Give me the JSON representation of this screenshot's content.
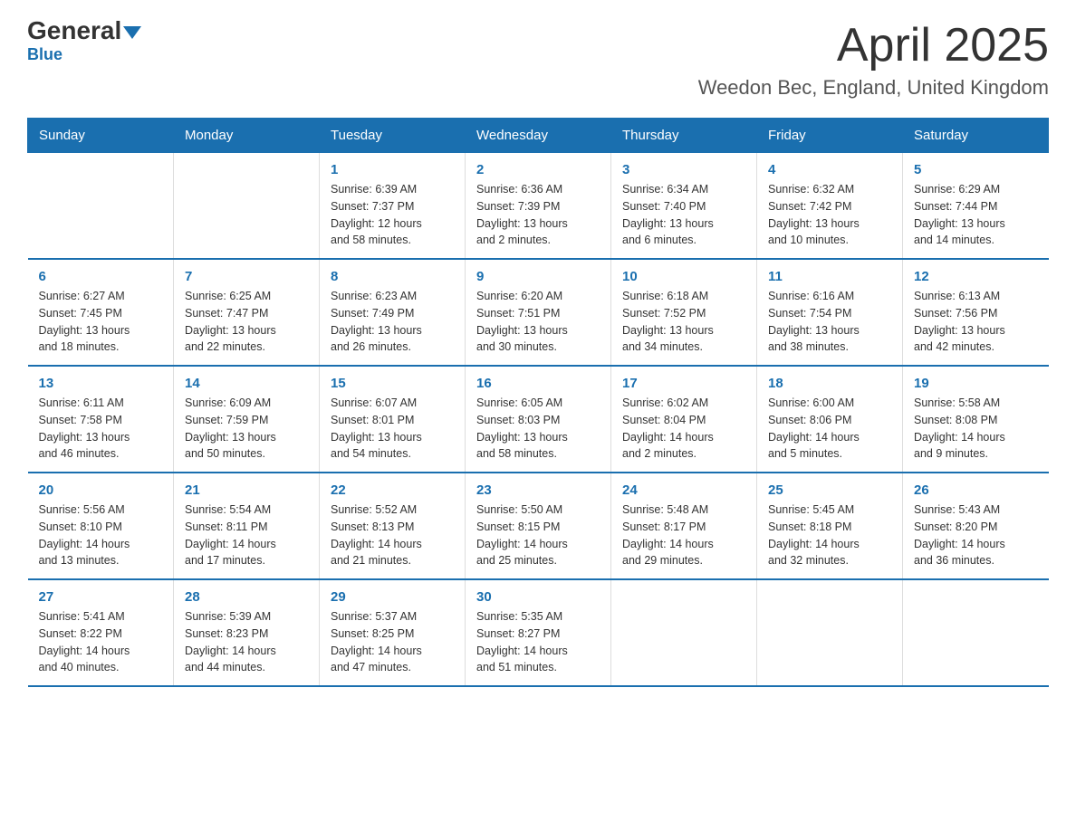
{
  "logo": {
    "general": "General",
    "blue": "Blue"
  },
  "header": {
    "month": "April 2025",
    "location": "Weedon Bec, England, United Kingdom"
  },
  "days_of_week": [
    "Sunday",
    "Monday",
    "Tuesday",
    "Wednesday",
    "Thursday",
    "Friday",
    "Saturday"
  ],
  "weeks": [
    [
      {
        "day": "",
        "info": ""
      },
      {
        "day": "",
        "info": ""
      },
      {
        "day": "1",
        "info": "Sunrise: 6:39 AM\nSunset: 7:37 PM\nDaylight: 12 hours\nand 58 minutes."
      },
      {
        "day": "2",
        "info": "Sunrise: 6:36 AM\nSunset: 7:39 PM\nDaylight: 13 hours\nand 2 minutes."
      },
      {
        "day": "3",
        "info": "Sunrise: 6:34 AM\nSunset: 7:40 PM\nDaylight: 13 hours\nand 6 minutes."
      },
      {
        "day": "4",
        "info": "Sunrise: 6:32 AM\nSunset: 7:42 PM\nDaylight: 13 hours\nand 10 minutes."
      },
      {
        "day": "5",
        "info": "Sunrise: 6:29 AM\nSunset: 7:44 PM\nDaylight: 13 hours\nand 14 minutes."
      }
    ],
    [
      {
        "day": "6",
        "info": "Sunrise: 6:27 AM\nSunset: 7:45 PM\nDaylight: 13 hours\nand 18 minutes."
      },
      {
        "day": "7",
        "info": "Sunrise: 6:25 AM\nSunset: 7:47 PM\nDaylight: 13 hours\nand 22 minutes."
      },
      {
        "day": "8",
        "info": "Sunrise: 6:23 AM\nSunset: 7:49 PM\nDaylight: 13 hours\nand 26 minutes."
      },
      {
        "day": "9",
        "info": "Sunrise: 6:20 AM\nSunset: 7:51 PM\nDaylight: 13 hours\nand 30 minutes."
      },
      {
        "day": "10",
        "info": "Sunrise: 6:18 AM\nSunset: 7:52 PM\nDaylight: 13 hours\nand 34 minutes."
      },
      {
        "day": "11",
        "info": "Sunrise: 6:16 AM\nSunset: 7:54 PM\nDaylight: 13 hours\nand 38 minutes."
      },
      {
        "day": "12",
        "info": "Sunrise: 6:13 AM\nSunset: 7:56 PM\nDaylight: 13 hours\nand 42 minutes."
      }
    ],
    [
      {
        "day": "13",
        "info": "Sunrise: 6:11 AM\nSunset: 7:58 PM\nDaylight: 13 hours\nand 46 minutes."
      },
      {
        "day": "14",
        "info": "Sunrise: 6:09 AM\nSunset: 7:59 PM\nDaylight: 13 hours\nand 50 minutes."
      },
      {
        "day": "15",
        "info": "Sunrise: 6:07 AM\nSunset: 8:01 PM\nDaylight: 13 hours\nand 54 minutes."
      },
      {
        "day": "16",
        "info": "Sunrise: 6:05 AM\nSunset: 8:03 PM\nDaylight: 13 hours\nand 58 minutes."
      },
      {
        "day": "17",
        "info": "Sunrise: 6:02 AM\nSunset: 8:04 PM\nDaylight: 14 hours\nand 2 minutes."
      },
      {
        "day": "18",
        "info": "Sunrise: 6:00 AM\nSunset: 8:06 PM\nDaylight: 14 hours\nand 5 minutes."
      },
      {
        "day": "19",
        "info": "Sunrise: 5:58 AM\nSunset: 8:08 PM\nDaylight: 14 hours\nand 9 minutes."
      }
    ],
    [
      {
        "day": "20",
        "info": "Sunrise: 5:56 AM\nSunset: 8:10 PM\nDaylight: 14 hours\nand 13 minutes."
      },
      {
        "day": "21",
        "info": "Sunrise: 5:54 AM\nSunset: 8:11 PM\nDaylight: 14 hours\nand 17 minutes."
      },
      {
        "day": "22",
        "info": "Sunrise: 5:52 AM\nSunset: 8:13 PM\nDaylight: 14 hours\nand 21 minutes."
      },
      {
        "day": "23",
        "info": "Sunrise: 5:50 AM\nSunset: 8:15 PM\nDaylight: 14 hours\nand 25 minutes."
      },
      {
        "day": "24",
        "info": "Sunrise: 5:48 AM\nSunset: 8:17 PM\nDaylight: 14 hours\nand 29 minutes."
      },
      {
        "day": "25",
        "info": "Sunrise: 5:45 AM\nSunset: 8:18 PM\nDaylight: 14 hours\nand 32 minutes."
      },
      {
        "day": "26",
        "info": "Sunrise: 5:43 AM\nSunset: 8:20 PM\nDaylight: 14 hours\nand 36 minutes."
      }
    ],
    [
      {
        "day": "27",
        "info": "Sunrise: 5:41 AM\nSunset: 8:22 PM\nDaylight: 14 hours\nand 40 minutes."
      },
      {
        "day": "28",
        "info": "Sunrise: 5:39 AM\nSunset: 8:23 PM\nDaylight: 14 hours\nand 44 minutes."
      },
      {
        "day": "29",
        "info": "Sunrise: 5:37 AM\nSunset: 8:25 PM\nDaylight: 14 hours\nand 47 minutes."
      },
      {
        "day": "30",
        "info": "Sunrise: 5:35 AM\nSunset: 8:27 PM\nDaylight: 14 hours\nand 51 minutes."
      },
      {
        "day": "",
        "info": ""
      },
      {
        "day": "",
        "info": ""
      },
      {
        "day": "",
        "info": ""
      }
    ]
  ]
}
